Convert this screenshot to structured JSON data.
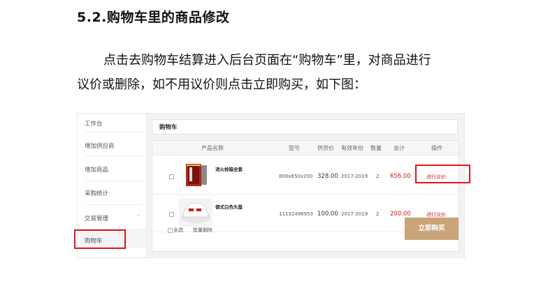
{
  "doc": {
    "title": "5.2.购物车里的商品修改",
    "line1": "点击去购物车结算进入后台页面在“购物车”里，对商品进行",
    "line2": "议价或删除，如不用议价则点击立即购买，如下图："
  },
  "shot": {
    "sidebar": [
      "工作台",
      "增加供应商",
      "增加商品",
      "采购统计",
      "交易管理",
      "购物车"
    ],
    "panel_title": "购物车",
    "headers": [
      "产品名称",
      "型号",
      "供货价",
      "有效年份",
      "数量",
      "总计",
      "操作"
    ],
    "rows": [
      {
        "name": "消火栓箱全套",
        "model": "800x650x200",
        "price": "328.00",
        "years": "2017-2019",
        "qty": "2",
        "total": "656.00",
        "op": "进行议价"
      },
      {
        "name": "德式白色头盔",
        "model": "11132496953",
        "price": "100.00",
        "years": "2017-2019",
        "qty": "2",
        "total": "200.00",
        "op": "进行议价"
      }
    ],
    "select_all": "全选",
    "batch_delete": "批量删除",
    "buy_now": "立即购买",
    "accent": "#c9a478",
    "highlight": "#d9161c"
  }
}
